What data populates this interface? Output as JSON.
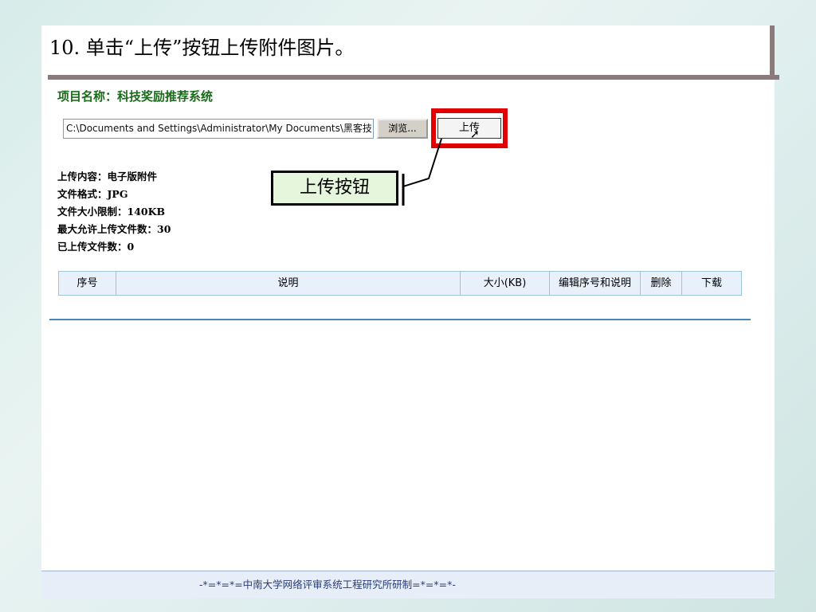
{
  "slide_title": "10. 单击“上传”按钮上传附件图片。",
  "project_label": "项目名称：科技奖励推荐系统",
  "file_input": {
    "value": "C:\\Documents and Settings\\Administrator\\My Documents\\黑客技"
  },
  "browse_label": "浏览...",
  "upload_label": "上传",
  "callout_label": "上传按钮",
  "info": [
    "上传内容：电子版附件",
    "文件格式：JPG",
    "文件大小限制：140KB",
    "最大允许上传文件数：30",
    "已上传文件数：0"
  ],
  "table": {
    "columns": [
      "序号",
      "说明",
      "大小(KB)",
      "编辑序号和说明",
      "删除",
      "下载"
    ]
  },
  "footer_text": "-*=*=*=中南大学网络评审系统工程研究所研制=*=*=*-",
  "colors": {
    "highlight": "#e30000",
    "project_green": "#1a6b1a",
    "callout_bg": "#e6f6dc"
  }
}
